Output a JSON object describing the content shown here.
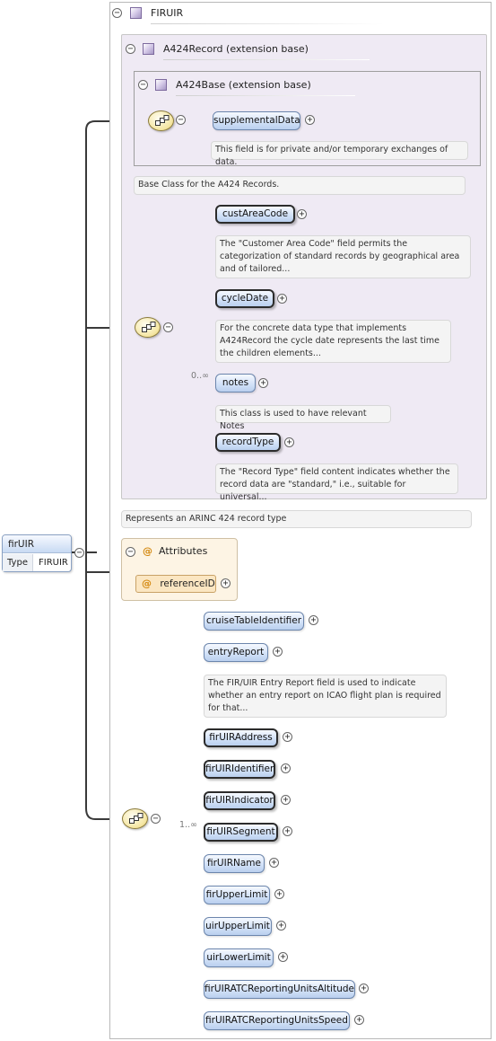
{
  "root": {
    "name": "firUIR",
    "type_label": "Type",
    "type_value": "FIRUIR"
  },
  "type_section": {
    "title": "FIRUIR",
    "annotation": "Represents an ARINC 424 record type"
  },
  "a424record": {
    "title": "A424Record (extension base)",
    "annotation": "Base Class for the A424 Records."
  },
  "a424base": {
    "title": "A424Base (extension base)",
    "element": {
      "name": "supplementalData",
      "annotation": "This field is for private and/or temporary exchanges of data."
    }
  },
  "record_elements": [
    {
      "name": "custAreaCode",
      "annotation_lines": [
        "The \"Customer Area Code\" field permits the",
        "categorization of standard records by geographical area",
        "and of tailored..."
      ]
    },
    {
      "name": "cycleDate",
      "annotation_lines": [
        "For the concrete data type that implements",
        "A424Record the cycle date represents the last time",
        "the children elements..."
      ]
    },
    {
      "name": "notes",
      "cardinality": "0..∞",
      "annotation_lines": [
        "This class is used to have relevant Notes"
      ]
    },
    {
      "name": "recordType",
      "annotation_lines": [
        "The \"Record Type\" field content indicates whether the",
        "record data are \"standard,\" i.e., suitable for universal..."
      ]
    }
  ],
  "attributes": {
    "title": "Attributes",
    "items": [
      {
        "name": "referenceID"
      }
    ]
  },
  "fir_elements": [
    {
      "name": "cruiseTableIdentifier"
    },
    {
      "name": "entryReport",
      "annotation_lines": [
        "The FIR/UIR Entry Report field is used to indicate",
        "whether an entry report on ICAO flight plan is required",
        "for that..."
      ]
    },
    {
      "name": "firUIRAddress"
    },
    {
      "name": "firUIRIdentifier"
    },
    {
      "name": "firUIRIndicator"
    },
    {
      "name": "firUIRSegment",
      "cardinality": "1..∞"
    },
    {
      "name": "firUIRName"
    },
    {
      "name": "firUpperLimit"
    },
    {
      "name": "uirUpperLimit"
    },
    {
      "name": "uirLowerLimit"
    },
    {
      "name": "firUIRATCReportingUnitsAltitude"
    },
    {
      "name": "firUIRATCReportingUnitsSpeed"
    }
  ],
  "symbols": {
    "collapse": "−",
    "expand": "+",
    "attribute": "@"
  },
  "colors": {
    "element_fill": "#d3e2f8",
    "sequence_fill": "#f5e7a6",
    "section_fill": "#efeaf4",
    "attributes_fill": "#fdf4e4"
  }
}
